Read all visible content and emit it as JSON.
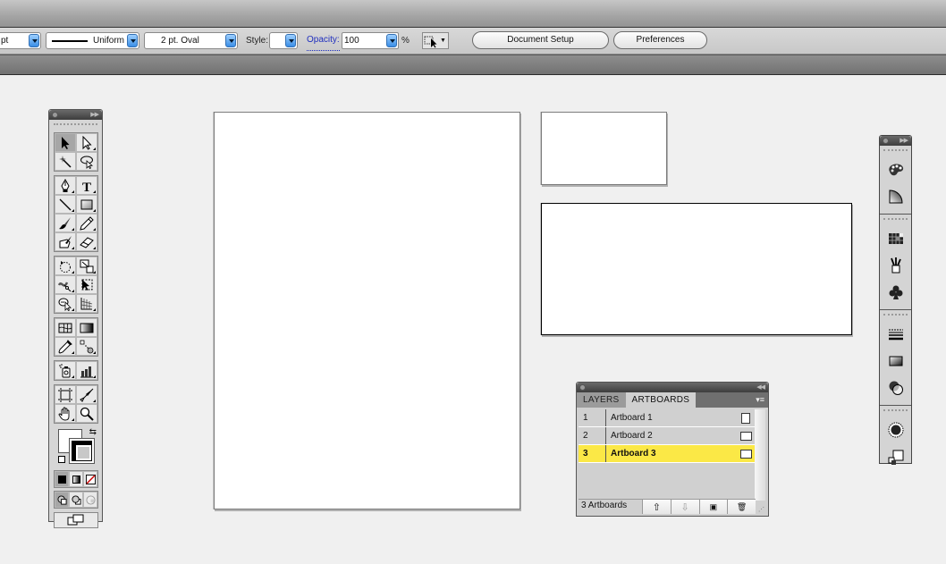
{
  "control_bar": {
    "stroke_weight_unit": "pt",
    "stroke_profile": "Uniform",
    "brush": "2 pt. Oval",
    "brush_prefix": "·",
    "style_label": "Style:",
    "opacity_label": "Opacity:",
    "opacity_value": "100",
    "opacity_unit": "%",
    "document_setup_label": "Document Setup",
    "preferences_label": "Preferences"
  },
  "tools_panel": {
    "rows": [
      [
        "selection-tool",
        "direct-selection-tool"
      ],
      [
        "magic-wand-tool",
        "lasso-tool"
      ],
      [
        "pen-tool",
        "type-tool"
      ],
      [
        "line-segment-tool",
        "rectangle-tool"
      ],
      [
        "paintbrush-tool",
        "pencil-tool"
      ],
      [
        "blob-brush-tool",
        "eraser-tool"
      ],
      [
        "rotate-tool",
        "scale-tool"
      ],
      [
        "warp-tool",
        "free-transform-tool"
      ],
      [
        "shape-builder-tool",
        "perspective-grid-tool"
      ],
      [
        "mesh-tool",
        "gradient-tool"
      ],
      [
        "eyedropper-tool",
        "blend-tool"
      ],
      [
        "symbol-sprayer-tool",
        "column-graph-tool"
      ],
      [
        "artboard-tool",
        "slice-tool"
      ],
      [
        "hand-tool",
        "zoom-tool"
      ]
    ],
    "swap_glyph": "⇆"
  },
  "artboards_panel": {
    "tabs": [
      {
        "label": "LAYERS",
        "active": false
      },
      {
        "label": "ARTBOARDS",
        "active": true
      }
    ],
    "menu_glyph": "▾≡",
    "rows": [
      {
        "num": "1",
        "name": "Artboard 1",
        "orientation": "portrait",
        "selected": false
      },
      {
        "num": "2",
        "name": "Artboard 2",
        "orientation": "landscape",
        "selected": false
      },
      {
        "num": "3",
        "name": "Artboard 3",
        "orientation": "landscape",
        "selected": true
      }
    ],
    "count_label": "3 Artboards",
    "footer_buttons": {
      "move_up": "⇧",
      "move_down": "⇩",
      "new": "▣",
      "delete": "🗑"
    }
  },
  "canvas": {
    "artboards": [
      {
        "id": "artboard-1",
        "selected": false
      },
      {
        "id": "artboard-2",
        "selected": false
      },
      {
        "id": "artboard-3",
        "selected": true
      }
    ]
  },
  "dock": {
    "groups": [
      [
        "color-guide-icon",
        "color-icon"
      ],
      [
        "swatches-icon",
        "brushes-icon",
        "symbols-icon"
      ],
      [
        "stroke-icon",
        "gradient-icon",
        "transparency-icon"
      ],
      [
        "appearance-icon",
        "graphic-styles-icon"
      ]
    ]
  },
  "colors": {
    "selected_row": "#fbe846",
    "accent_blue": "#3a8ee6",
    "link_blue": "#1f2fbf"
  }
}
